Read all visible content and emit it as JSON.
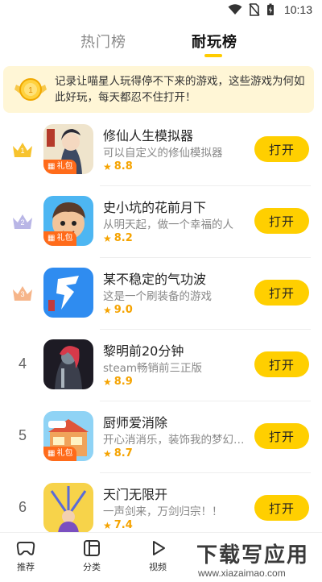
{
  "status_bar": {
    "time": "10:13"
  },
  "tabs": [
    {
      "label": "热门榜",
      "active": false
    },
    {
      "label": "耐玩榜",
      "active": true
    }
  ],
  "banner": {
    "text": "记录让喵星人玩得停不下来的游戏，这些游戏为何如此好玩，每天都忍不住打开！"
  },
  "gift_label": "礼包",
  "open_label": "打开",
  "games": [
    {
      "rank": "1",
      "title": "修仙人生模拟器",
      "desc": "可以自定义的修仙模拟器",
      "score": "8.8",
      "gift": true,
      "icon": "cultivation-hero-icon"
    },
    {
      "rank": "2",
      "title": "史小坑的花前月下",
      "desc": "从明天起，做一个幸福的人",
      "score": "8.2",
      "gift": true,
      "icon": "cartoon-boy-icon"
    },
    {
      "rank": "3",
      "title": "某不稳定的气功波",
      "desc": "这是一个刷装备的游戏",
      "score": "9.0",
      "gift": false,
      "icon": "wave-character-icon"
    },
    {
      "rank": "4",
      "title": "黎明前20分钟",
      "desc": "steam畅销前三正版",
      "score": "8.9",
      "gift": false,
      "icon": "dark-warrior-icon"
    },
    {
      "rank": "5",
      "title": "厨师爱消除",
      "desc": "开心消消乐，装饰我的梦幻餐厅",
      "score": "8.7",
      "gift": true,
      "icon": "cafe-building-icon"
    },
    {
      "rank": "6",
      "title": "天门无限开",
      "desc": "一声剑来，万剑归宗！！",
      "score": "7.4",
      "gift": false,
      "icon": "swords-hero-icon"
    }
  ],
  "bottom_nav": [
    {
      "label": "推荐",
      "icon": "gamepad-icon"
    },
    {
      "label": "分类",
      "icon": "category-icon"
    },
    {
      "label": "视频",
      "icon": "play-icon"
    }
  ],
  "watermark": {
    "big": "下载写应用",
    "small": "www.xiazaimao.com"
  },
  "colors": {
    "accent": "#ffcf00",
    "gift": "#ff6b1a",
    "score": "#f5a300",
    "banner_bg": "#fff6d6"
  }
}
